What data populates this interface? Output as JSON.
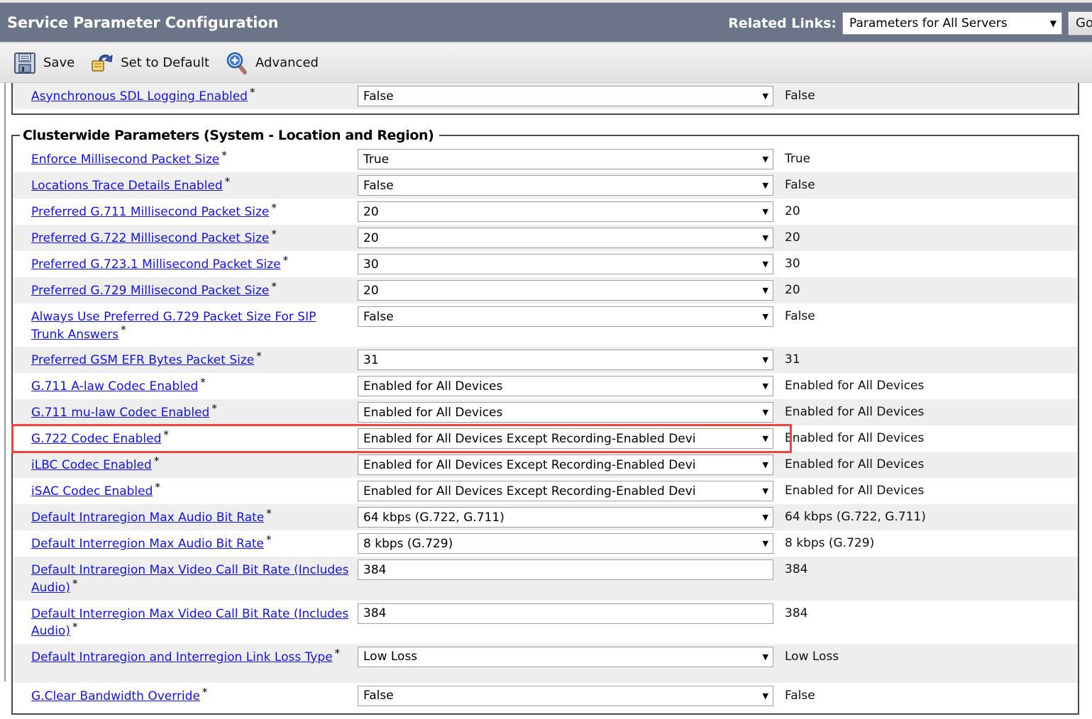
{
  "header": {
    "title": "Service Parameter Configuration",
    "related_links_label": "Related Links:",
    "related_links_value": "Parameters for All Servers",
    "go_label": "Go",
    "caret": "▼",
    "bar_color": "#6b7488"
  },
  "toolbar": {
    "items": [
      {
        "icon": "save-icon",
        "label": "Save"
      },
      {
        "icon": "set-to-default-icon",
        "label": "Set to Default"
      },
      {
        "icon": "advanced-magnifier-icon",
        "label": "Advanced"
      }
    ]
  },
  "highlight": {
    "color": "#ee4540",
    "target_row": "G.722 Codec Enabled"
  },
  "groups": [
    {
      "legend": "",
      "first": true,
      "rows": [
        {
          "label": "Asynchronous SDL Logging Enabled",
          "required": "*",
          "control": "select",
          "value": "False",
          "default": "False",
          "alt": true,
          "tall": false
        }
      ]
    },
    {
      "legend": "Clusterwide Parameters (System - Location and Region)",
      "first": false,
      "rows": [
        {
          "label": "Enforce Millisecond Packet Size",
          "required": "*",
          "control": "select",
          "value": "True",
          "default": "True",
          "alt": false,
          "tall": false
        },
        {
          "label": "Locations Trace Details Enabled",
          "required": "*",
          "control": "select",
          "value": "False",
          "default": "False",
          "alt": true,
          "tall": false
        },
        {
          "label": "Preferred G.711 Millisecond Packet Size",
          "required": "*",
          "control": "select",
          "value": "20",
          "default": "20",
          "alt": false,
          "tall": false
        },
        {
          "label": "Preferred G.722 Millisecond Packet Size",
          "required": "*",
          "control": "select",
          "value": "20",
          "default": "20",
          "alt": true,
          "tall": false
        },
        {
          "label": "Preferred G.723.1 Millisecond Packet Size",
          "required": "*",
          "control": "select",
          "value": "30",
          "default": "30",
          "alt": false,
          "tall": false
        },
        {
          "label": "Preferred G.729 Millisecond Packet Size",
          "required": "*",
          "control": "select",
          "value": "20",
          "default": "20",
          "alt": true,
          "tall": false
        },
        {
          "label": "Always Use Preferred G.729 Packet Size For SIP Trunk Answers",
          "required": "*",
          "control": "select",
          "value": "False",
          "default": "False",
          "alt": false,
          "tall": true
        },
        {
          "label": "Preferred GSM EFR Bytes Packet Size",
          "required": "*",
          "control": "select",
          "value": "31",
          "default": "31",
          "alt": true,
          "tall": false
        },
        {
          "label": "G.711 A-law Codec Enabled",
          "required": "*",
          "control": "select",
          "value": "Enabled for All Devices",
          "default": "Enabled for All Devices",
          "alt": false,
          "tall": false
        },
        {
          "label": "G.711 mu-law Codec Enabled",
          "required": "*",
          "control": "select",
          "value": "Enabled for All Devices",
          "default": "Enabled for All Devices",
          "alt": true,
          "tall": false
        },
        {
          "label": "G.722 Codec Enabled",
          "required": "*",
          "control": "select",
          "value": "Enabled for All Devices Except Recording-Enabled Devi",
          "default": "Enabled for All Devices",
          "alt": false,
          "tall": false,
          "highlighted": true
        },
        {
          "label": "iLBC Codec Enabled",
          "required": "*",
          "control": "select",
          "value": "Enabled for All Devices Except Recording-Enabled Devi",
          "default": "Enabled for All Devices",
          "alt": true,
          "tall": false
        },
        {
          "label": "iSAC Codec Enabled",
          "required": "*",
          "control": "select",
          "value": "Enabled for All Devices Except Recording-Enabled Devi",
          "default": "Enabled for All Devices",
          "alt": false,
          "tall": false
        },
        {
          "label": "Default Intraregion Max Audio Bit Rate",
          "required": "*",
          "control": "select",
          "value": "64 kbps (G.722, G.711)",
          "default": "64 kbps (G.722, G.711)",
          "alt": true,
          "tall": false
        },
        {
          "label": "Default Interregion Max Audio Bit Rate",
          "required": "*",
          "control": "select",
          "value": "8 kbps (G.729)",
          "default": "8 kbps (G.729)",
          "alt": false,
          "tall": false
        },
        {
          "label": "Default Intraregion Max Video Call Bit Rate (Includes Audio)",
          "required": "*",
          "control": "input",
          "value": "384",
          "default": "384",
          "alt": true,
          "tall": true
        },
        {
          "label": "Default Interregion Max Video Call Bit Rate (Includes Audio)",
          "required": "*",
          "control": "input",
          "value": "384",
          "default": "384",
          "alt": false,
          "tall": true
        },
        {
          "label": "Default Intraregion and Interregion Link Loss Type",
          "required": "*",
          "control": "select",
          "value": "Low Loss",
          "default": "Low Loss",
          "alt": true,
          "tall": true
        },
        {
          "label": "G.Clear Bandwidth Override",
          "required": "*",
          "control": "select",
          "value": "False",
          "default": "False",
          "alt": false,
          "tall": false
        }
      ]
    }
  ]
}
